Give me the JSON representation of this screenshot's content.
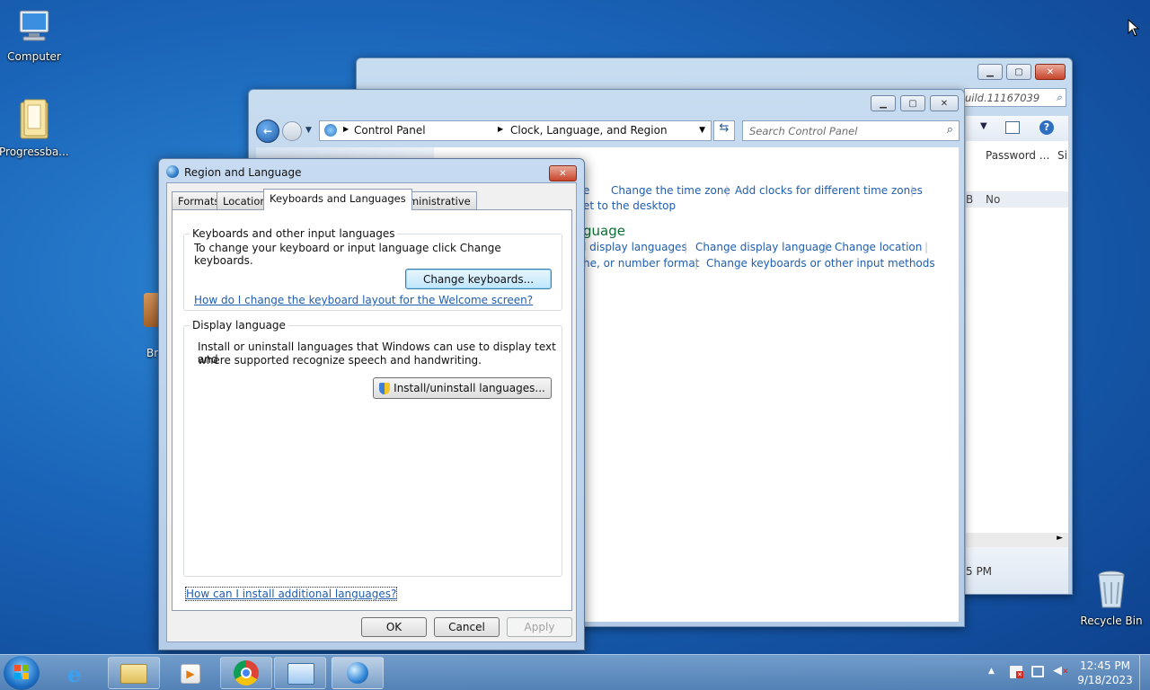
{
  "desktop": {
    "icons": [
      {
        "label": "Computer"
      },
      {
        "label": "Progressba..."
      },
      {
        "label": "Br"
      },
      {
        "label": "Recycle Bin"
      }
    ]
  },
  "back_window": {
    "search_partial": "uild.11167039",
    "column_password": "Password ...",
    "column_si": "Si",
    "cell_b": "B",
    "cell_no": "No",
    "time_partial": "5 PM"
  },
  "control_panel": {
    "breadcrumb": [
      "Control Panel",
      "Clock, Language, and Region"
    ],
    "search_placeholder": "Search Control Panel",
    "section1_links": [
      "e",
      "Change the time zone",
      "Add clocks for different time zones"
    ],
    "section1_link2": "et to the desktop",
    "section2_heading": "guage",
    "section2_links_row1": [
      "l display languages",
      "Change display language",
      "Change location"
    ],
    "section2_links_row2": [
      "he, or number format",
      "Change keyboards or other input methods"
    ]
  },
  "dialog": {
    "title": "Region and Language",
    "tabs": [
      "Formats",
      "Location",
      "Keyboards and Languages",
      "Administrative"
    ],
    "keyboards_group_title": "Keyboards and other input languages",
    "keyboards_text": "To change your keyboard or input language click Change keyboards.",
    "change_keyboards_button": "Change keyboards...",
    "welcome_link": "How do I change the keyboard layout for the Welcome screen?",
    "display_group_title": "Display language",
    "display_text_line1": "Install or uninstall languages that Windows can use to display text and",
    "display_text_line2": "where supported recognize speech and handwriting.",
    "install_button": "Install/uninstall languages...",
    "additional_link": "How can I install additional languages?",
    "ok": "OK",
    "cancel": "Cancel",
    "apply": "Apply"
  },
  "taskbar": {
    "time": "12:45 PM",
    "date": "9/18/2023"
  }
}
